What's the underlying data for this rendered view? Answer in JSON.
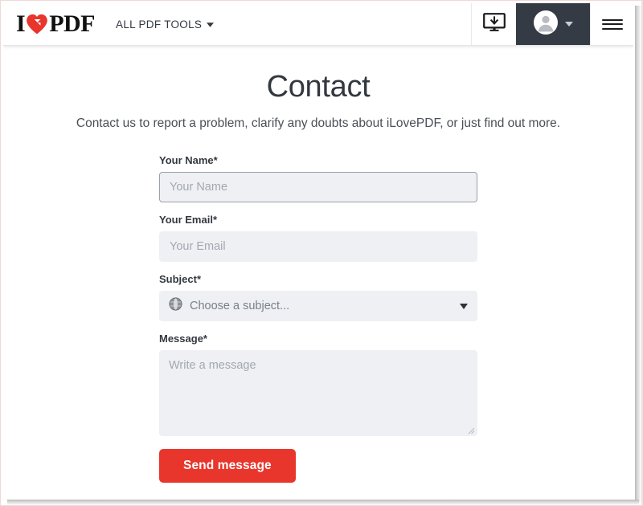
{
  "header": {
    "logo": {
      "text_before": "I",
      "text_after": "PDF",
      "heart_icon": "heart-icon",
      "alt": "iLovePDF"
    },
    "nav": {
      "all_tools_label": "ALL PDF TOOLS",
      "all_tools_caret": "▾"
    },
    "actions": {
      "desktop_icon": "desktop-download-icon",
      "account_icon": "user-avatar-icon",
      "account_caret": "chevron-down-icon",
      "menu_icon": "hamburger-menu-icon"
    },
    "colors": {
      "brand_red": "#e8362c",
      "account_panel": "#353b45"
    }
  },
  "main": {
    "title": "Contact",
    "subtitle": "Contact us to report a problem, clarify any doubts about iLovePDF, or just find out more."
  },
  "form": {
    "name": {
      "label": "Your Name",
      "required_mark": "*",
      "placeholder": "Your Name",
      "value": "",
      "focused": true
    },
    "email": {
      "label": "Your Email",
      "required_mark": "*",
      "placeholder": "Your Email",
      "value": ""
    },
    "subject": {
      "label": "Subject",
      "required_mark": "*",
      "selected": "Choose a subject...",
      "icon": "globe-icon",
      "caret": "▼"
    },
    "message": {
      "label": "Message",
      "required_mark": "*",
      "placeholder": "Write a message",
      "value": ""
    },
    "submit": {
      "label": "Send message",
      "color": "#e8362c"
    }
  }
}
